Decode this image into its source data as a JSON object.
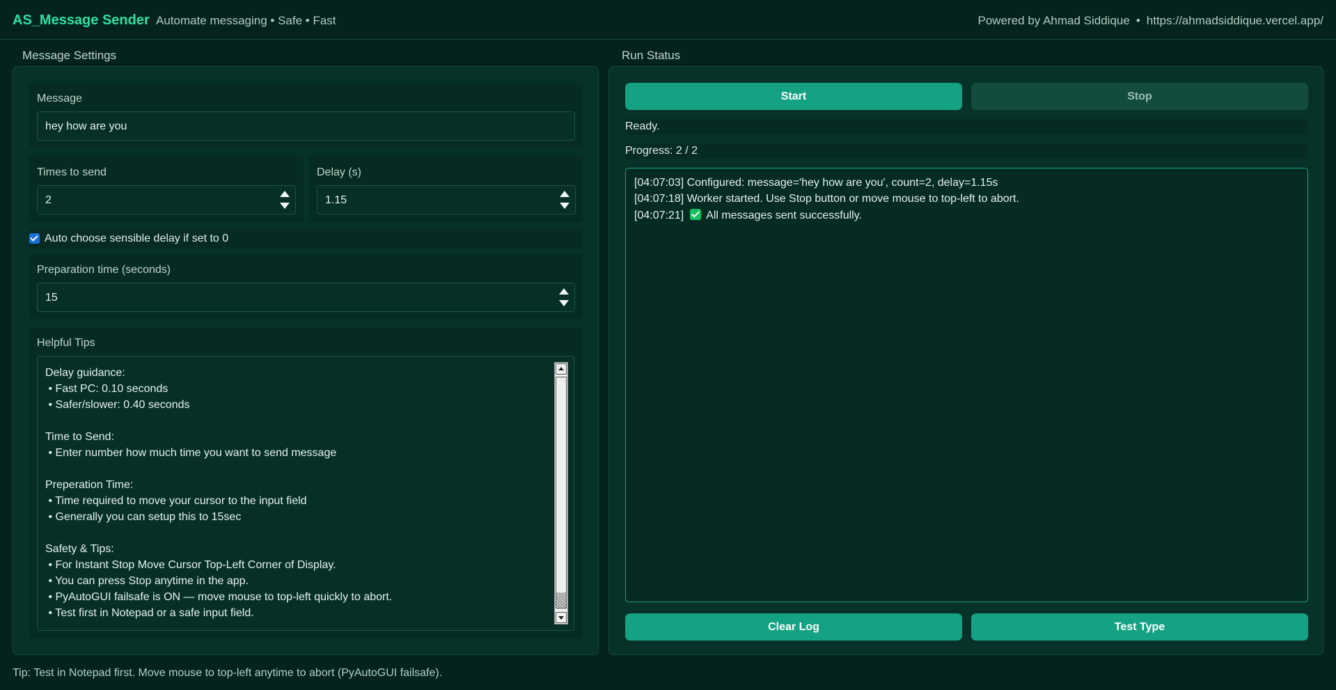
{
  "header": {
    "brand": "AS_Message Sender",
    "tagline": "Automate messaging • Safe • Fast",
    "powered_by": "Powered by Ahmad Siddique",
    "separator": "•",
    "url": "https://ahmadsiddique.vercel.app/"
  },
  "settings": {
    "title": "Message Settings",
    "message": {
      "label": "Message",
      "value": "hey how are you"
    },
    "times": {
      "label": "Times to send",
      "value": "2"
    },
    "delay": {
      "label": "Delay (s)",
      "value": "1.15"
    },
    "auto_delay": {
      "label": "Auto choose sensible delay if set to 0",
      "checked": true
    },
    "prep": {
      "label": "Preparation time (seconds)",
      "value": "15"
    },
    "tips": {
      "label": "Helpful Tips",
      "text": "Delay guidance:\n • Fast PC: 0.10 seconds\n • Safer/slower: 0.40 seconds\n\nTime to Send:\n • Enter number how much time you want to send message\n\nPreperation Time:\n • Time required to move your cursor to the input field\n • Generally you can setup this to 15sec\n\nSafety & Tips:\n • For Instant Stop Move Cursor Top-Left Corner of Display.\n • You can press Stop anytime in the app.\n • PyAutoGUI failsafe is ON — move mouse to top-left quickly to abort.\n • Test first in Notepad or a safe input field."
    }
  },
  "run": {
    "title": "Run  Status",
    "start_label": "Start",
    "stop_label": "Stop",
    "status": "Ready.",
    "progress": "Progress: 2 / 2",
    "log": {
      "line1": "[04:07:03] Configured: message='hey how are you', count=2, delay=1.15s",
      "line2": "[04:07:18] Worker started. Use Stop button or move mouse to top-left to abort.",
      "line3_time": "[04:07:21]",
      "line3_text": "All messages sent successfully."
    },
    "clear_label": "Clear Log",
    "test_label": "Test Type"
  },
  "footer": {
    "tip": "Tip: Test in Notepad first. Move mouse to top-left anytime to abort (PyAutoGUI failsafe)."
  },
  "colors": {
    "background": "#03231c",
    "accent": "#14a283",
    "brand": "#2fe0a6",
    "checkbox": "#1a6fd9"
  }
}
